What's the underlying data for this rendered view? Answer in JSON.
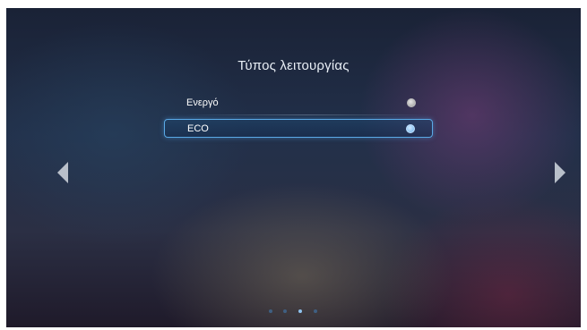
{
  "dialog": {
    "title": "Τύπος λειτουργίας"
  },
  "options": [
    {
      "label": "Ενεργό",
      "selected": false
    },
    {
      "label": "ECO",
      "selected": true
    }
  ],
  "navigation": {
    "prev_icon": "triangle-left-icon",
    "next_icon": "triangle-right-icon"
  },
  "pagination": {
    "total_pages": 4,
    "current_page": 3
  },
  "colors": {
    "accent": "#5aa9e6",
    "text": "#ffffff"
  }
}
